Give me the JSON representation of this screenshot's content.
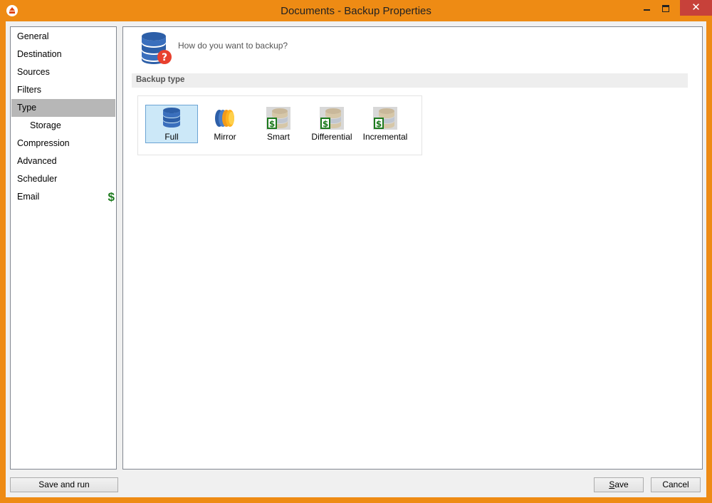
{
  "window": {
    "title": "Documents - Backup Properties",
    "close_glyph": "✕"
  },
  "sidebar": {
    "items": [
      {
        "label": "General"
      },
      {
        "label": "Destination"
      },
      {
        "label": "Sources"
      },
      {
        "label": "Filters"
      },
      {
        "label": "Type",
        "selected": true
      },
      {
        "label": "Storage",
        "sub": true
      },
      {
        "label": "Compression"
      },
      {
        "label": "Advanced"
      },
      {
        "label": "Scheduler"
      },
      {
        "label": "Email",
        "badge": "$"
      }
    ]
  },
  "main": {
    "header_text": "How do you want to backup?",
    "section_label": "Backup type",
    "types": [
      {
        "label": "Full",
        "selected": true,
        "icon": "database-stack-icon"
      },
      {
        "label": "Mirror",
        "icon": "mirror-icon"
      },
      {
        "label": "Smart",
        "icon": "paid-database-icon"
      },
      {
        "label": "Differential",
        "icon": "paid-database-icon"
      },
      {
        "label": "Incremental",
        "icon": "paid-database-icon"
      }
    ]
  },
  "footer": {
    "save_and_run": "Save and run",
    "save_first": "S",
    "save_rest": "ave",
    "cancel": "Cancel"
  },
  "colors": {
    "frame": "#ee8b14",
    "selected_nav": "#b7b7b7",
    "selected_type": "#cce8f8",
    "paid_badge": "#1d7a1d"
  }
}
